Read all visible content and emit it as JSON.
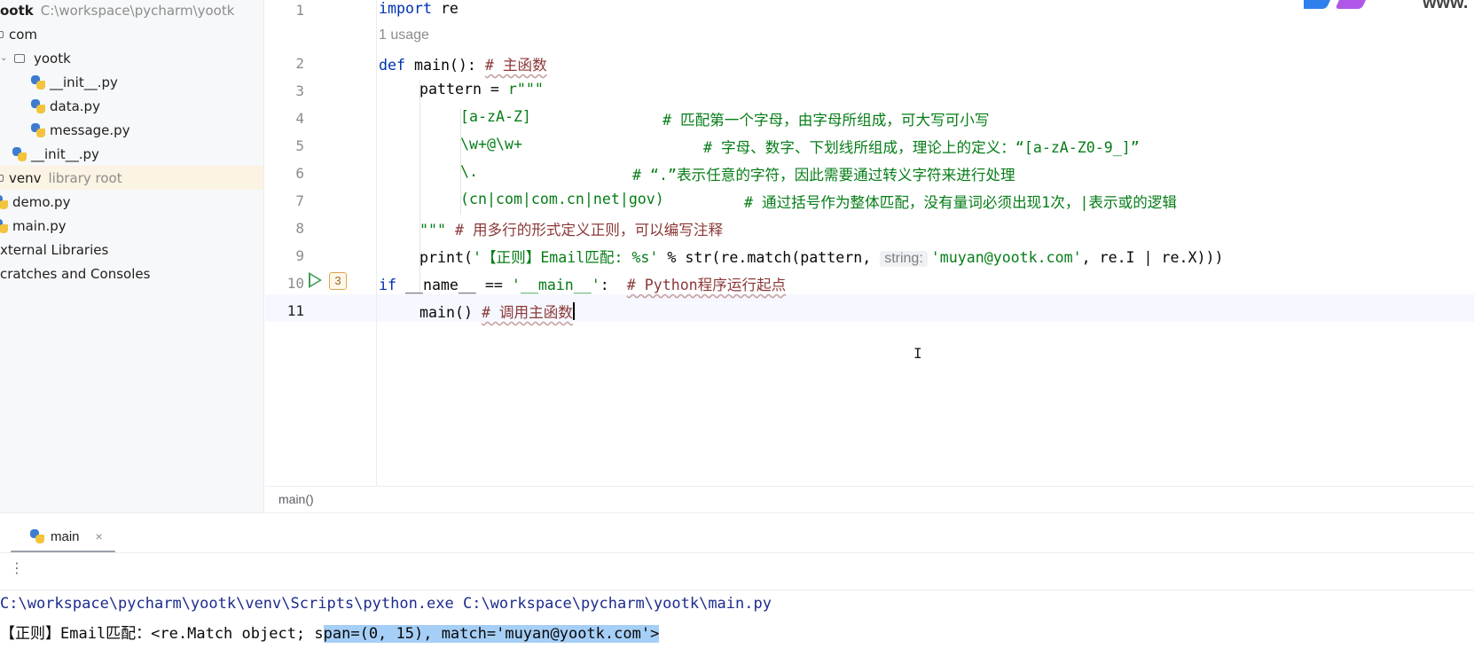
{
  "project": {
    "root_name": "ootk",
    "root_path": "C:\\workspace\\pycharm\\yootk",
    "items": [
      {
        "label": "com",
        "type": "folder"
      },
      {
        "label": "yootk",
        "type": "folder"
      },
      {
        "label": "__init__.py",
        "type": "python-file"
      },
      {
        "label": "data.py",
        "type": "python-file"
      },
      {
        "label": "message.py",
        "type": "python-file"
      },
      {
        "label": "__init__.py",
        "type": "python-file"
      },
      {
        "label": "venv",
        "secondary": "library root",
        "type": "folder",
        "selected": true
      },
      {
        "label": "demo.py",
        "type": "python-file"
      },
      {
        "label": "main.py",
        "type": "python-file"
      },
      {
        "label": "xternal Libraries",
        "type": "libraries"
      },
      {
        "label": "cratches and Consoles",
        "type": "scratches"
      }
    ]
  },
  "editor": {
    "usage_hint": "1 usage",
    "current_line": 11,
    "run_badge": "3",
    "line_numbers": [
      "1",
      "2",
      "3",
      "4",
      "5",
      "6",
      "7",
      "8",
      "9",
      "10",
      "11"
    ],
    "lines": {
      "l1": {
        "kw": "import",
        "rest": " re"
      },
      "l2": {
        "kw": "def",
        "name": " main(): ",
        "comment": "# 主函数"
      },
      "l3": {
        "code": "pattern = ",
        "str": "r\"\"\""
      },
      "l4": {
        "str": "[a-zA-Z]",
        "comment": "# 匹配第一个字母，由字母所组成，可大写可小写"
      },
      "l5": {
        "str": "\\w+@\\w+",
        "comment": "# 字母、数字、下划线所组成，理论上的定义：“[a-zA-Z0-9_]”"
      },
      "l6": {
        "str": "\\.",
        "comment": "# “.”表示任意的字符，因此需要通过转义字符来进行处理"
      },
      "l7": {
        "str": "(cn|com|com.cn|net|gov)",
        "comment": "# 通过括号作为整体匹配，没有量词必须出现1次，|表示或的逻辑"
      },
      "l8": {
        "str": "\"\"\"",
        "comment": "# 用多行的形式定义正则，可以编写注释"
      },
      "l9": {
        "pre": "print(",
        "str1": "'【正则】Email匹配: %s'",
        "mid": " % str(re.match(pattern, ",
        "inlay": "string:",
        "str2": "'muyan@yootk.com'",
        "post": ", re.I | re.X)))"
      },
      "l10": {
        "kw": "if",
        "code": " __name__ == ",
        "str": "'__main__'",
        "sep": ":  ",
        "comment": "# Python程序运行起点"
      },
      "l11": {
        "code": "main() ",
        "comment": "# 调用主函数"
      }
    },
    "breadcrumb": "main()",
    "mouse_cursor": "I"
  },
  "run": {
    "tab_label": "main",
    "close_glyph": "×",
    "more_glyph": "⋮",
    "command": "C:\\workspace\\pycharm\\yootk\\venv\\Scripts\\python.exe C:\\workspace\\pycharm\\yootk\\main.py",
    "output_plain": "【正则】Email匹配：<re.Match object; s",
    "output_selected": "pan=(0, 15), match='muyan@yootk.com'>"
  },
  "logo": {
    "text": "www."
  },
  "icons": {
    "folder": "folder-icon",
    "python": "python-file-icon",
    "run": "run-icon",
    "close": "close-icon"
  },
  "colors": {
    "keyword": "#0033b3",
    "string": "#067d17",
    "comment": "#8c8c8c",
    "selection": "#a6cff7",
    "selected_row": "#fbf3e3"
  }
}
